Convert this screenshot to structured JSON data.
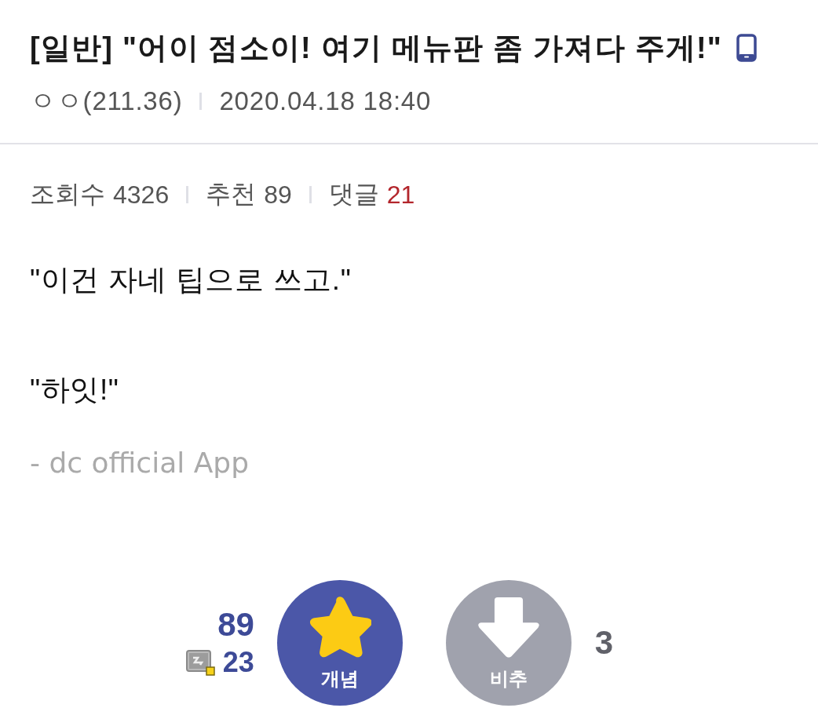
{
  "post": {
    "category": "[일반]",
    "title": "\"어이 점소이! 여기 메뉴판 좀 가져다 주게!\"",
    "from_mobile": true,
    "author": "ㅇㅇ(211.36)",
    "date": "2020.04.18 18:40"
  },
  "stats": [
    {
      "label": "조회수",
      "value": "4326",
      "highlight": false
    },
    {
      "label": "추천",
      "value": "89",
      "highlight": false
    },
    {
      "label": "댓글",
      "value": "21",
      "highlight": true
    }
  ],
  "body": {
    "paragraphs": [
      "\"이건 자네 팁으로 쓰고.\"",
      "\"하잇!\""
    ],
    "signature": "- dc official App"
  },
  "votes": {
    "up": {
      "count": "89",
      "fixed_count": "23",
      "label": "개념"
    },
    "down": {
      "label": "비추",
      "count": "3"
    }
  }
}
